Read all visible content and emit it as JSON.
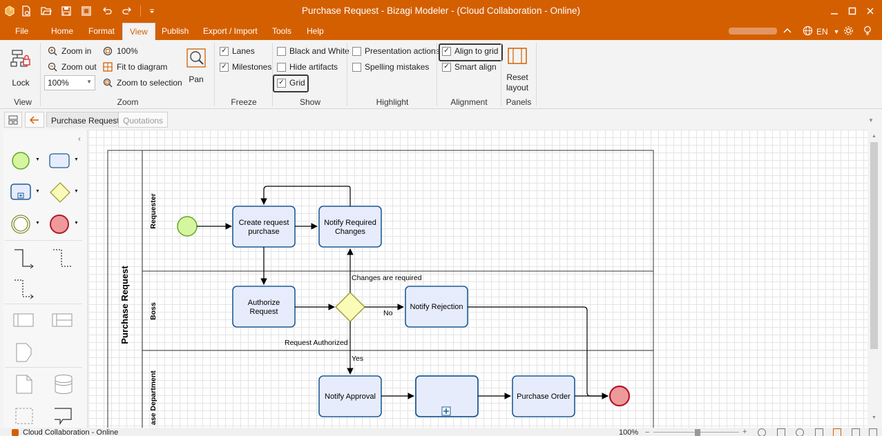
{
  "window": {
    "title": "Purchase Request - Bizagi Modeler - (Cloud Collaboration - Online)",
    "minimize_icon": "minimize-icon",
    "maximize_icon": "maximize-icon",
    "close_icon": "close-icon"
  },
  "quick_access": [
    "app-logo-icon",
    "new-file-icon",
    "open-icon",
    "save-icon",
    "save-as-icon",
    "undo-icon",
    "redo-icon",
    "customize-icon"
  ],
  "menu": {
    "items": [
      {
        "label": "File"
      },
      {
        "label": "Home"
      },
      {
        "label": "Format"
      },
      {
        "label": "View"
      },
      {
        "label": "Publish"
      },
      {
        "label": "Export / Import"
      },
      {
        "label": "Tools"
      },
      {
        "label": "Help"
      }
    ],
    "active": "View",
    "language": "EN"
  },
  "ribbon": {
    "view": {
      "lock_label": "Lock",
      "group_label": "View"
    },
    "zoom": {
      "zoom_in": "Zoom in",
      "zoom_out": "Zoom out",
      "zoom_value": "100%",
      "zoom_100": "100%",
      "fit_to_diagram": "Fit to diagram",
      "zoom_to_selection": "Zoom to selection",
      "pan": "Pan",
      "group_label": "Zoom"
    },
    "freeze": {
      "lanes": "Lanes",
      "milestones": "Milestones",
      "group_label": "Freeze"
    },
    "show": {
      "black_and_white": "Black and White",
      "hide_artifacts": "Hide artifacts",
      "grid": "Grid",
      "group_label": "Show"
    },
    "highlight": {
      "presentation_actions": "Presentation actions",
      "spelling_mistakes": "Spelling mistakes",
      "group_label": "Highlight"
    },
    "alignment": {
      "align_to_grid": "Align to grid",
      "smart_align": "Smart align",
      "group_label": "Alignment"
    },
    "panels": {
      "reset_layout_line1": "Reset",
      "reset_layout_line2": "layout",
      "group_label": "Panels"
    },
    "checked": {
      "lanes": true,
      "milestones": true,
      "black_and_white": false,
      "hide_artifacts": false,
      "grid": true,
      "presentation_actions": false,
      "spelling_mistakes": false,
      "align_to_grid": true,
      "smart_align": true
    }
  },
  "tabs": [
    {
      "label": "Purchase Request",
      "active": true
    },
    {
      "label": "Quotations",
      "active": false
    }
  ],
  "diagram": {
    "pool": "Purchase Request",
    "lanes": [
      "Requester",
      "Boss",
      "Purchase Department"
    ],
    "lane_partial_text": "ase Department",
    "tasks": {
      "create_request_1": "Create request",
      "create_request_2": "purchase",
      "notify_required_1": "Notify Required",
      "notify_required_2": "Changes",
      "authorize_1": "Authorize",
      "authorize_2": "Request",
      "notify_rejection": "Notify Rejection",
      "notify_approval": "Notify Approval",
      "purchase_order": "Purchase Order"
    },
    "flow_labels": {
      "changes_required": "Changes are required",
      "no": "No",
      "request_authorized": "Request Authorized",
      "yes": "Yes"
    },
    "colors": {
      "task_fill": "#e6ecfb",
      "task_stroke": "#1e5b96",
      "start_fill": "#d6f5a0",
      "start_stroke": "#5fa620",
      "end_fill": "#ef9a9a",
      "end_stroke": "#b0182a",
      "gateway_fill": "#fbfbb8",
      "gateway_stroke": "#9e9e3a",
      "accent": "#d45f00"
    }
  },
  "status": {
    "text": "Cloud Collaboration - Online",
    "zoom": "100%"
  }
}
